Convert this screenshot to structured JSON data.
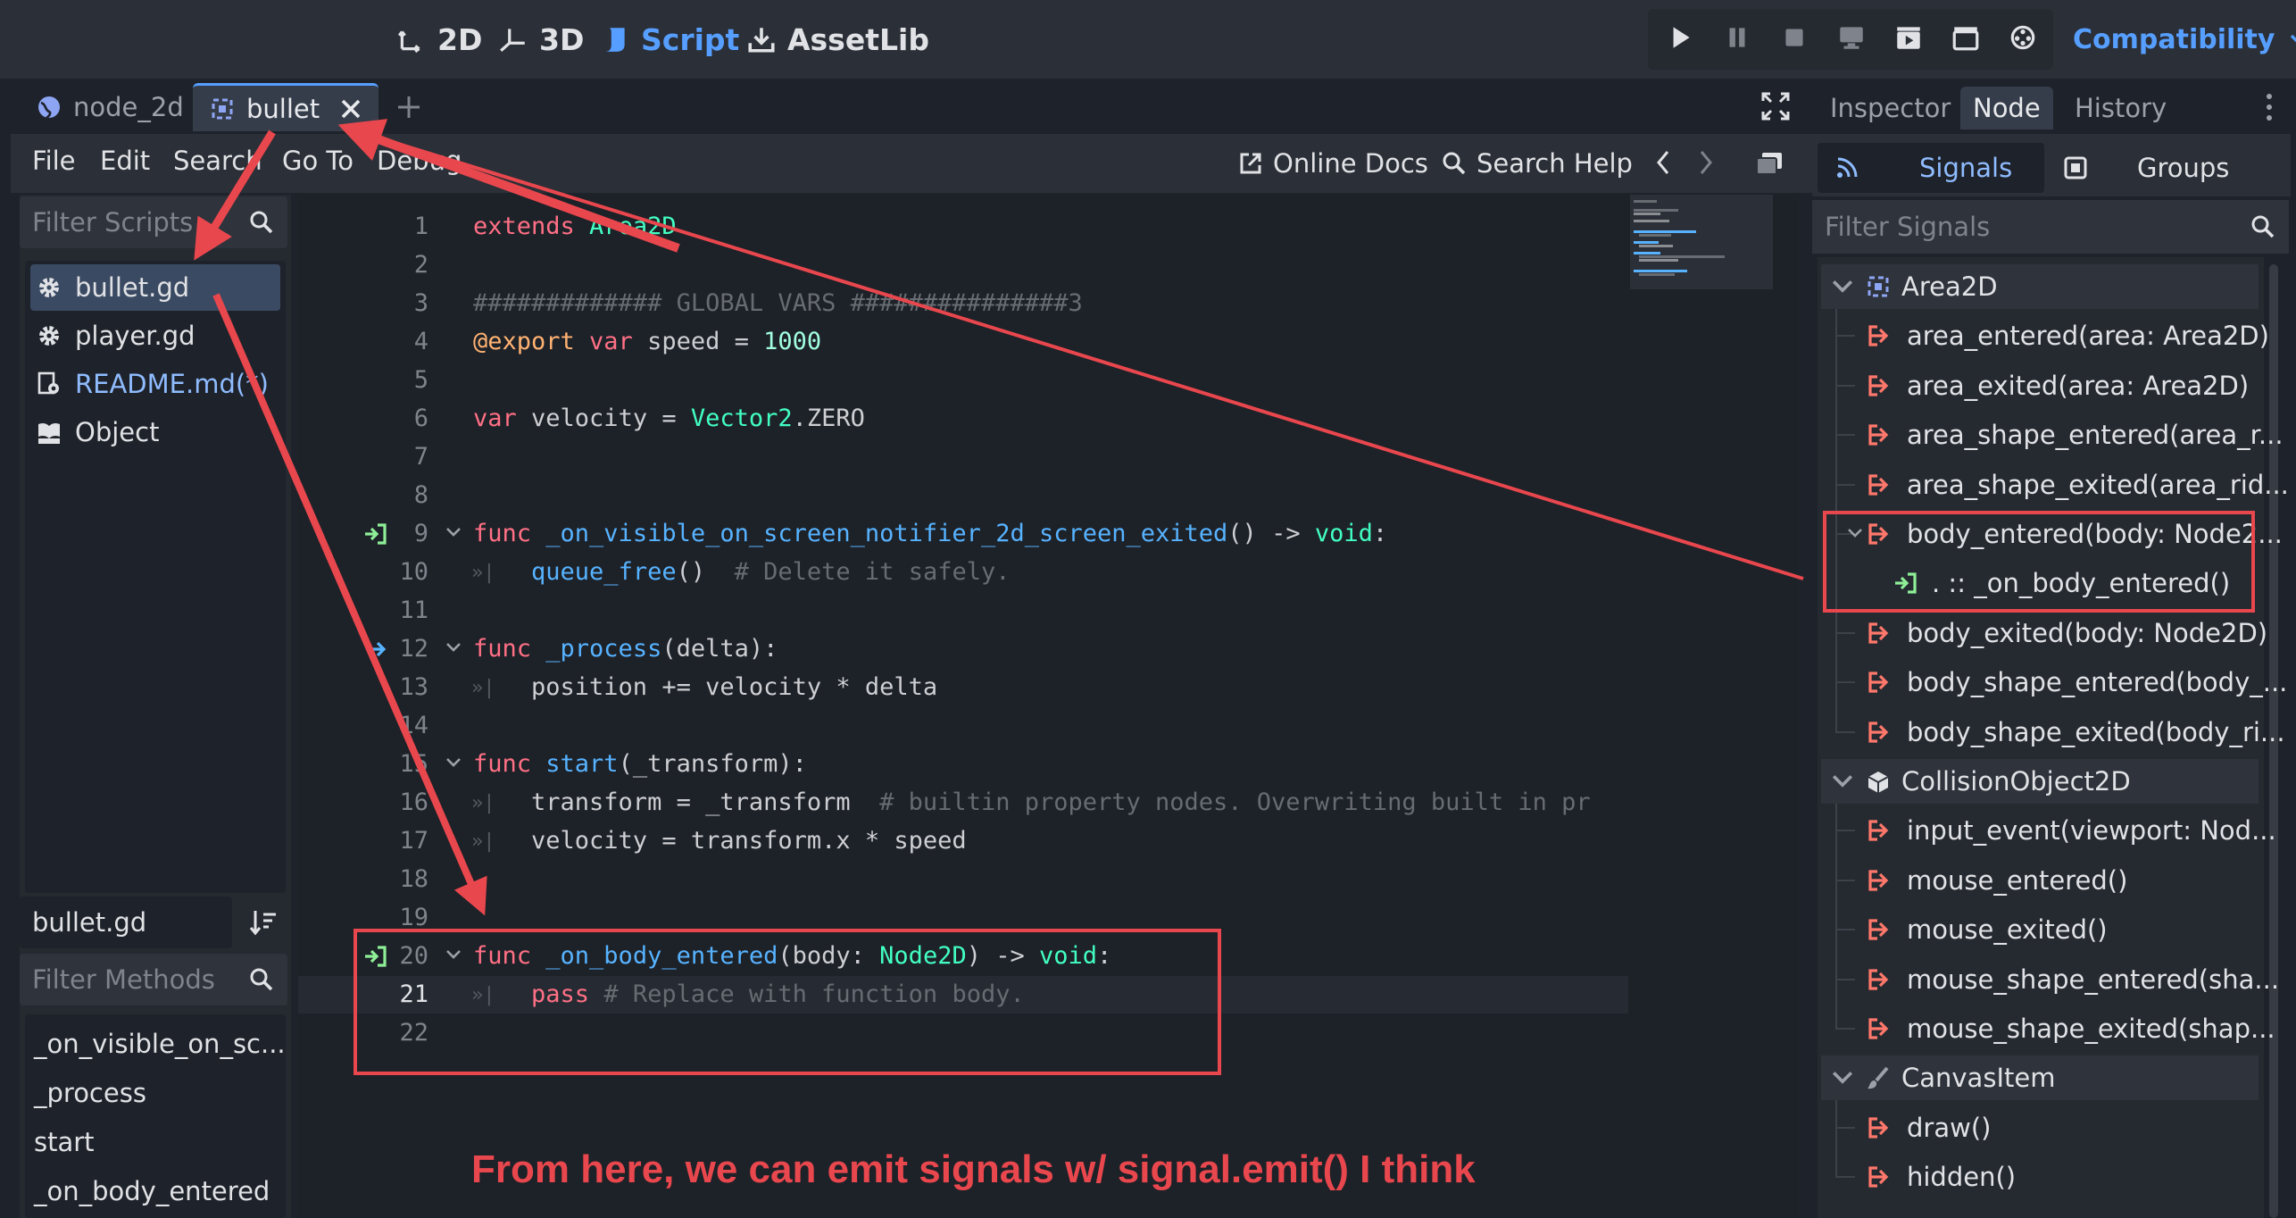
{
  "colors": {
    "accent": "#569eff",
    "annotation_red": "#e8474d",
    "keyword": "#ff7085",
    "function": "#57b3ff",
    "type": "#42ffc2",
    "comment": "#676b72",
    "signal_icon": "#ff786b",
    "connected_icon": "#8eef97"
  },
  "topbar": {
    "workspaces": [
      {
        "label": "2D",
        "icon": "2d-icon"
      },
      {
        "label": "3D",
        "icon": "3d-icon"
      },
      {
        "label": "Script",
        "icon": "script-icon",
        "active": true
      },
      {
        "label": "AssetLib",
        "icon": "assetlib-icon"
      }
    ],
    "renderer": "Compatibility"
  },
  "tabs": [
    {
      "label": "node_2d",
      "icon": "globe-icon"
    },
    {
      "label": "bullet",
      "icon": "area2d-icon",
      "active": true
    }
  ],
  "script_menu": {
    "items": [
      "File",
      "Edit",
      "Search",
      "Go To",
      "Debug"
    ],
    "online_docs": "Online Docs",
    "search_help": "Search Help"
  },
  "left_panel": {
    "filter_scripts_placeholder": "Filter Scripts",
    "scripts": [
      {
        "label": "bullet.gd",
        "icon": "gear-icon",
        "selected": true
      },
      {
        "label": "player.gd",
        "icon": "gear-icon"
      },
      {
        "label": "README.md(*)",
        "icon": "doc-gear-icon",
        "modified": true
      },
      {
        "label": "Object",
        "icon": "doc-icon"
      }
    ],
    "current_script": "bullet.gd",
    "filter_methods_placeholder": "Filter Methods",
    "methods": [
      "_on_visible_on_sc...",
      "_process",
      "start",
      "_on_body_entered"
    ]
  },
  "editor": {
    "lines": [
      {
        "n": "1",
        "segs": [
          [
            "kw",
            "extends "
          ],
          [
            "ty",
            "Area2D"
          ]
        ]
      },
      {
        "n": "2",
        "segs": []
      },
      {
        "n": "3",
        "segs": [
          [
            "cm",
            "############# GLOBAL VARS ###############3"
          ]
        ]
      },
      {
        "n": "4",
        "segs": [
          [
            "an",
            "@export "
          ],
          [
            "kw",
            "var "
          ],
          [
            "",
            "speed = "
          ],
          [
            "nm",
            "1000"
          ]
        ]
      },
      {
        "n": "5",
        "segs": []
      },
      {
        "n": "6",
        "segs": [
          [
            "kw",
            "var "
          ],
          [
            "",
            "velocity = "
          ],
          [
            "ty",
            "Vector2"
          ],
          [
            "",
            ".ZERO"
          ]
        ]
      },
      {
        "n": "7",
        "segs": []
      },
      {
        "n": "8",
        "segs": []
      },
      {
        "n": "9",
        "segs": [
          [
            "kw",
            "func "
          ],
          [
            "fn",
            "_on_visible_on_screen_notifier_2d_screen_exited"
          ],
          [
            "",
            "() -> "
          ],
          [
            "ty",
            "void"
          ],
          [
            "",
            ":"
          ]
        ],
        "fold": true,
        "signal": true
      },
      {
        "n": "10",
        "segs": [
          [
            "",
            "    "
          ],
          [
            "fn",
            "queue_free"
          ],
          [
            "",
            "()  "
          ],
          [
            "cm",
            "# Delete it safely."
          ]
        ],
        "tab": true
      },
      {
        "n": "11",
        "segs": []
      },
      {
        "n": "12",
        "segs": [
          [
            "kw",
            "func "
          ],
          [
            "fn",
            "_process"
          ],
          [
            "",
            "(delta):"
          ]
        ],
        "fold": true,
        "override": true
      },
      {
        "n": "13",
        "segs": [
          [
            "",
            "    position += velocity * delta"
          ]
        ],
        "tab": true
      },
      {
        "n": "14",
        "segs": []
      },
      {
        "n": "15",
        "segs": [
          [
            "kw",
            "func "
          ],
          [
            "fn",
            "start"
          ],
          [
            "",
            "(_transform):"
          ]
        ],
        "fold": true
      },
      {
        "n": "16",
        "segs": [
          [
            "",
            "    transform = _transform  "
          ],
          [
            "cm",
            "# builtin property nodes. Overwriting built in pr"
          ]
        ],
        "tab": true
      },
      {
        "n": "17",
        "segs": [
          [
            "",
            "    velocity = transform.x * speed"
          ]
        ],
        "tab": true
      },
      {
        "n": "18",
        "segs": []
      },
      {
        "n": "19",
        "segs": []
      },
      {
        "n": "20",
        "segs": [
          [
            "kw",
            "func "
          ],
          [
            "fn",
            "_on_body_entered"
          ],
          [
            "",
            "(body: "
          ],
          [
            "ty",
            "Node2D"
          ],
          [
            "",
            ") -> "
          ],
          [
            "ty",
            "void"
          ],
          [
            "",
            ":"
          ]
        ],
        "fold": true,
        "signal": true
      },
      {
        "n": "21",
        "segs": [
          [
            "",
            "    "
          ],
          [
            "kw",
            "pass "
          ],
          [
            "cm",
            "# Replace with function body."
          ]
        ],
        "tab": true,
        "current": true
      },
      {
        "n": "22",
        "segs": []
      }
    ],
    "annotation": "From here, we can emit signals w/ signal.emit() I think"
  },
  "right_dock": {
    "tabs": [
      "Inspector",
      "Node",
      "History"
    ],
    "active_tab": "Node",
    "subtabs": [
      "Signals",
      "Groups"
    ],
    "filter_placeholder": "Filter Signals",
    "groups": [
      {
        "label": "Area2D",
        "icon": "area2d-icon",
        "signals": [
          "area_entered(area: Area2D)",
          "area_exited(area: Area2D)",
          "area_shape_entered(area_r...",
          "area_shape_exited(area_rid...",
          "body_entered(body: Node2...",
          "body_exited(body: Node2D)",
          "body_shape_entered(body_...",
          "body_shape_exited(body_ri..."
        ],
        "connection": ". :: _on_body_entered()"
      },
      {
        "label": "CollisionObject2D",
        "icon": "cube-icon",
        "signals": [
          "input_event(viewport: Nod...",
          "mouse_entered()",
          "mouse_exited()",
          "mouse_shape_entered(sha...",
          "mouse_shape_exited(shap..."
        ]
      },
      {
        "label": "CanvasItem",
        "icon": "brush-icon",
        "signals": [
          "draw()",
          "hidden()"
        ]
      }
    ]
  }
}
